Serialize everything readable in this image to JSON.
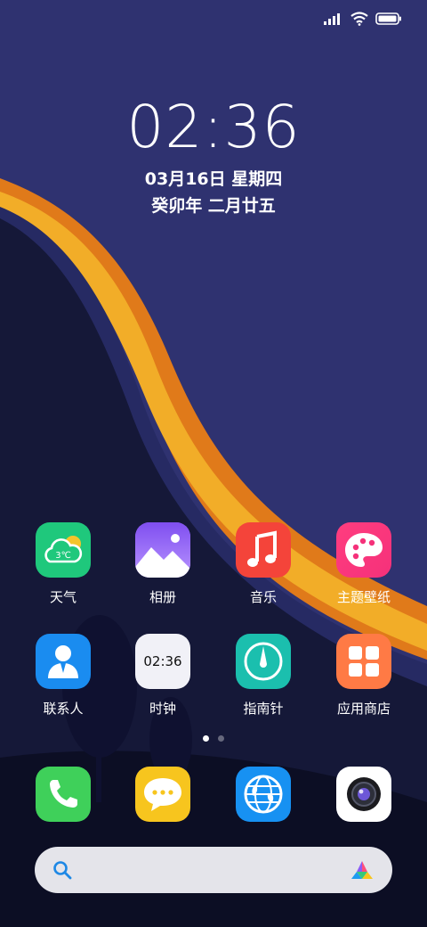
{
  "status_bar": {
    "signal": "signal-icon",
    "wifi": "wifi-icon",
    "battery": "battery-icon"
  },
  "lock": {
    "time": "02:36",
    "date": "03月16日 星期四",
    "lunar": "癸卯年 二月廿五"
  },
  "apps": [
    {
      "label": "天气",
      "icon": "weather-icon",
      "temp": "3℃"
    },
    {
      "label": "相册",
      "icon": "gallery-icon"
    },
    {
      "label": "音乐",
      "icon": "music-icon"
    },
    {
      "label": "主题壁纸",
      "icon": "theme-icon"
    },
    {
      "label": "联系人",
      "icon": "contacts-icon"
    },
    {
      "label": "时钟",
      "icon": "clock-icon",
      "time": "02:36"
    },
    {
      "label": "指南针",
      "icon": "compass-icon"
    },
    {
      "label": "应用商店",
      "icon": "app-store-icon"
    }
  ],
  "page_indicator": {
    "pages": 2,
    "current": 1
  },
  "dock": [
    {
      "icon": "phone-icon"
    },
    {
      "icon": "messages-icon"
    },
    {
      "icon": "browser-icon"
    },
    {
      "icon": "camera-icon"
    }
  ],
  "search": {
    "icon": "search-icon",
    "assistant_icon": "assistant-icon"
  },
  "colors": {
    "sky": "#2f3270",
    "hill": "#13163a",
    "orange": "#e88a1c",
    "yellow": "#f4b428"
  }
}
